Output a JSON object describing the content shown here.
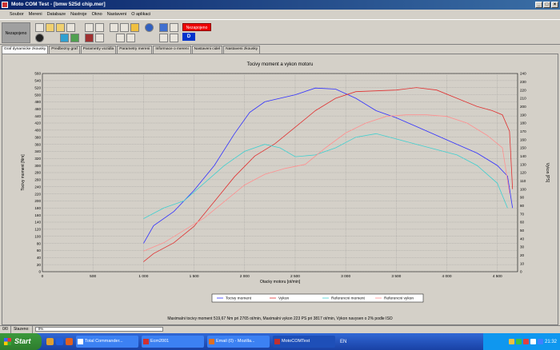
{
  "window": {
    "title": "Moto COM Test - [bmw 525d chip.mer]"
  },
  "menu": [
    "Soubor",
    "Mereni",
    "Databaze",
    "Nastroje",
    "Okno",
    "Nastaveni",
    "O aplikaci"
  ],
  "toolbar": {
    "connection_label": "Nezapojeno",
    "status_red": "Nezapojeno",
    "status_d": "D"
  },
  "tabs": [
    "Graf dynamicke zkousky",
    "Predbezny graf",
    "Parametry vozidla",
    "Parametry mereni",
    "Informace o mereni",
    "Nastaveni cidel",
    "Nastaveni zkousky"
  ],
  "legend": [
    "Tocivy moment",
    "Vykon",
    "Referencni moment",
    "Referencni vykon"
  ],
  "summary": "Maximalni tocivy moment 519,67 Nm pri 2765 ot/min,  Maximalni vykon 223 PS pri 3817 ot/min,  Vykon navysen o 2% podle ISO",
  "statusbar": {
    "left": "0/0",
    "label": "Stazeno:",
    "progress": "0%",
    "progress_fraction": 0
  },
  "taskbar": {
    "start": "Start",
    "tasks": [
      "Total Commander...",
      "Ecm2001",
      "Email (0) - Mozilla...",
      "MotoCOMTest"
    ],
    "lang": "EN",
    "clock": "21:32"
  },
  "colors": {
    "torque": "#3030ff",
    "power": "#e03030",
    "ref_torque": "#40d0d0",
    "ref_power": "#ff9090"
  },
  "chart_data": {
    "type": "line",
    "title": "Tocivy moment a vykon motoru",
    "xlabel": "Otacky motoru [ot/min]",
    "ylabel": "Tocivy moment [Nm]",
    "y2label": "Vykon [PS]",
    "xlim": [
      0,
      4700
    ],
    "ylim": [
      0,
      560
    ],
    "y2lim": [
      0,
      240
    ],
    "xticks": [
      "0",
      "500",
      "1 000",
      "1 500",
      "2 000",
      "2 500",
      "3 000",
      "3 500",
      "4 000",
      "4 500"
    ],
    "yticks": [
      "0",
      "20",
      "40",
      "60",
      "80",
      "100",
      "120",
      "140",
      "160",
      "180",
      "200",
      "220",
      "240",
      "260",
      "280",
      "300",
      "320",
      "340",
      "360",
      "380",
      "400",
      "420",
      "440",
      "460",
      "480",
      "500",
      "520",
      "540",
      "560"
    ],
    "y2ticks": [
      "0",
      "10",
      "20",
      "30",
      "40",
      "50",
      "60",
      "70",
      "80",
      "90",
      "100",
      "110",
      "120",
      "130",
      "140",
      "150",
      "160",
      "170",
      "180",
      "190",
      "200",
      "210",
      "220",
      "230",
      "240"
    ],
    "grid": true,
    "legend_position": "bottom",
    "series": [
      {
        "name": "Tocivy moment",
        "axis": "left",
        "x": [
          1000,
          1100,
          1300,
          1500,
          1700,
          1900,
          2050,
          2200,
          2350,
          2500,
          2700,
          2900,
          3100,
          3300,
          3500,
          3700,
          3900,
          4100,
          4300,
          4500,
          4600,
          4650
        ],
        "y": [
          80,
          130,
          170,
          230,
          300,
          390,
          450,
          480,
          490,
          500,
          519,
          516,
          490,
          455,
          435,
          410,
          385,
          360,
          335,
          300,
          270,
          180
        ]
      },
      {
        "name": "Vykon",
        "axis": "right",
        "x": [
          1000,
          1100,
          1300,
          1500,
          1700,
          1900,
          2100,
          2300,
          2500,
          2700,
          2900,
          3100,
          3300,
          3500,
          3700,
          3900,
          4100,
          4300,
          4450,
          4550,
          4620,
          4650
        ],
        "y": [
          12,
          22,
          35,
          55,
          85,
          115,
          140,
          155,
          175,
          195,
          210,
          218,
          219,
          220,
          223,
          220,
          210,
          200,
          195,
          190,
          170,
          100
        ]
      },
      {
        "name": "Referencni moment",
        "axis": "left",
        "x": [
          1000,
          1200,
          1400,
          1600,
          1800,
          2000,
          2200,
          2350,
          2500,
          2700,
          2900,
          3100,
          3300,
          3500,
          3700,
          3900,
          4100,
          4300,
          4500,
          4600
        ],
        "y": [
          150,
          180,
          200,
          250,
          300,
          340,
          360,
          350,
          325,
          330,
          350,
          380,
          390,
          375,
          360,
          345,
          330,
          300,
          250,
          180
        ]
      },
      {
        "name": "Referencni vykon",
        "axis": "right",
        "x": [
          1000,
          1200,
          1400,
          1600,
          1800,
          2000,
          2200,
          2400,
          2600,
          2800,
          3000,
          3200,
          3400,
          3600,
          3800,
          4000,
          4200,
          4400,
          4550,
          4620
        ],
        "y": [
          25,
          35,
          50,
          65,
          85,
          105,
          118,
          125,
          130,
          150,
          168,
          180,
          188,
          190,
          190,
          188,
          180,
          165,
          150,
          95
        ]
      }
    ]
  }
}
